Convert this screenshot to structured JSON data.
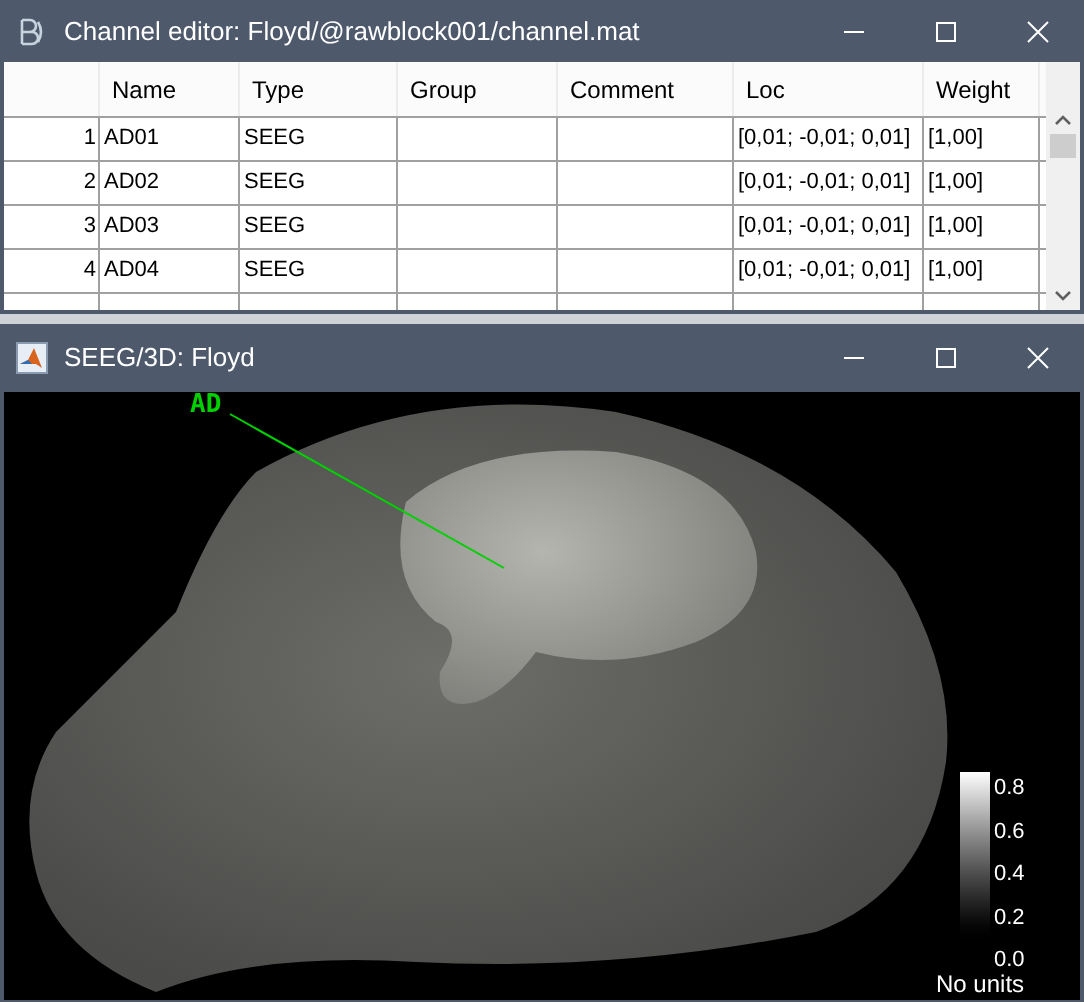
{
  "editor_window": {
    "title": "Channel editor: Floyd/@rawblock001/channel.mat"
  },
  "table": {
    "columns": [
      "Name",
      "Type",
      "Group",
      "Comment",
      "Loc",
      "Weight"
    ],
    "rows": [
      {
        "index": "1",
        "name": "AD01",
        "type": "SEEG",
        "loc": "[0,01; -0,01; 0,01]",
        "weight": "[1,00]"
      },
      {
        "index": "2",
        "name": "AD02",
        "type": "SEEG",
        "loc": "[0,01; -0,01; 0,01]",
        "weight": "[1,00]"
      },
      {
        "index": "3",
        "name": "AD03",
        "type": "SEEG",
        "loc": "[0,01; -0,01; 0,01]",
        "weight": "[1,00]"
      },
      {
        "index": "4",
        "name": "AD04",
        "type": "SEEG",
        "loc": "[0,01; -0,01; 0,01]",
        "weight": "[1,00]"
      }
    ]
  },
  "viewer_window": {
    "title": "SEEG/3D: Floyd",
    "electrode_label": "AD"
  },
  "colorbar": {
    "ticks": [
      "0.8",
      "0.6",
      "0.4",
      "0.2",
      "0.0"
    ],
    "units": "No units"
  }
}
